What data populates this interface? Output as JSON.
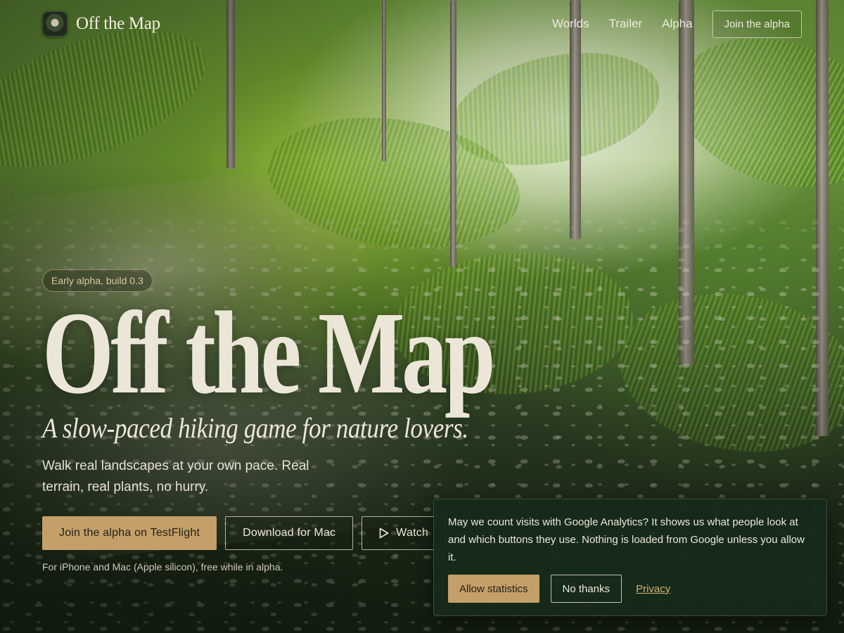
{
  "nav": {
    "brand": "Off the Map",
    "links": [
      "Worlds",
      "Trailer",
      "Alpha"
    ],
    "cta": "Join the alpha"
  },
  "hero": {
    "badge": "Early alpha, build 0.3",
    "title": "Off the Map",
    "subtitle": "A slow-paced hiking game for nature lovers.",
    "description": "Walk real landscapes at your own pace. Real terrain, real plants, no hurry.",
    "buttons": {
      "testflight": "Join the alpha on TestFlight",
      "mac": "Download for Mac",
      "trailer": "Watch"
    },
    "note": "For iPhone and Mac (Apple silicon), free while in alpha."
  },
  "consent": {
    "text": "May we count visits with Google Analytics? It shows us what people look at and which buttons they use. Nothing is loaded from Google unless you allow it.",
    "allow": "Allow statistics",
    "deny": "No thanks",
    "privacy": "Privacy"
  },
  "colors": {
    "accent": "#c59f69",
    "text": "#ece6d8",
    "card_bg": "#162a1a"
  },
  "icons": {
    "logo": "compass-app-icon",
    "trailer_button": "play-icon"
  }
}
